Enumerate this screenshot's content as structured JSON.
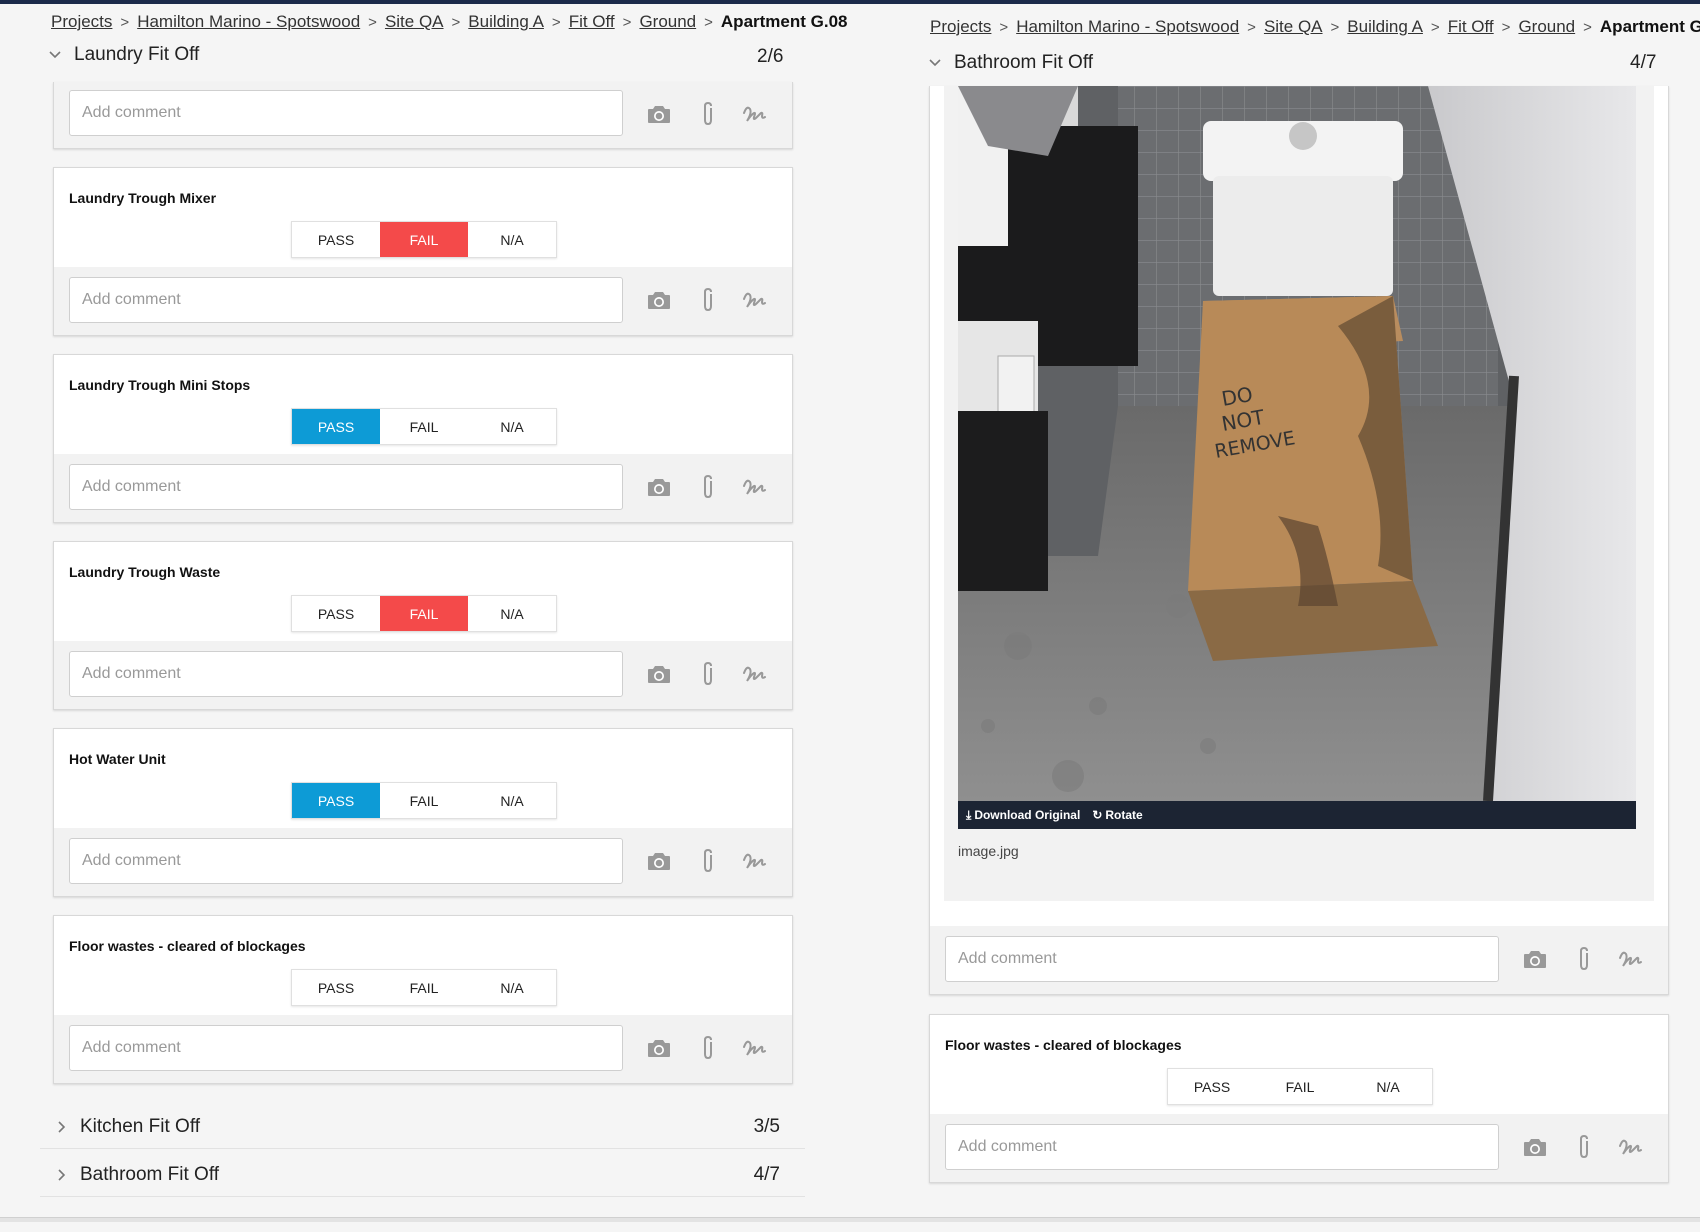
{
  "left": {
    "breadcrumb": [
      "Projects",
      "Hamilton Marino - Spotswood",
      "Site QA",
      "Building A",
      "Fit Off",
      "Ground"
    ],
    "breadcrumb_current": "Apartment G.08",
    "section": {
      "title": "Laundry Fit Off",
      "count": "2/6"
    },
    "comment_placeholder": "Add comment",
    "items": [
      {
        "title": "Laundry Trough Mixer",
        "state": "FAIL"
      },
      {
        "title": "Laundry Trough Mini Stops",
        "state": "PASS"
      },
      {
        "title": "Laundry Trough Waste",
        "state": "FAIL"
      },
      {
        "title": "Hot Water Unit",
        "state": "PASS"
      },
      {
        "title": "Floor wastes - cleared of blockages",
        "state": "NONE"
      }
    ],
    "collapsed_sections": [
      {
        "title": "Kitchen Fit Off",
        "count": "3/5"
      },
      {
        "title": "Bathroom Fit Off",
        "count": "4/7"
      }
    ]
  },
  "right": {
    "breadcrumb": [
      "Projects",
      "Hamilton Marino - Spotswood",
      "Site QA",
      "Building A",
      "Fit Off",
      "Ground"
    ],
    "breadcrumb_current": "Apartment G.08",
    "section": {
      "title": "Bathroom Fit Off",
      "count": "4/7"
    },
    "photo": {
      "download_label": "Download Original",
      "rotate_label": "Rotate",
      "filename": "image.jpg",
      "box_text": [
        "DO",
        "NOT",
        "REMOVE"
      ]
    },
    "comment_placeholder": "Add comment",
    "items": [
      {
        "title": "Floor wastes - cleared of blockages",
        "state": "NONE"
      }
    ]
  },
  "buttons": {
    "pass": "PASS",
    "fail": "FAIL",
    "na": "N/A"
  },
  "colors": {
    "pass_active": "#0d9bd6",
    "fail_active": "#f44a4a",
    "topbar": "#1b2a4a"
  }
}
